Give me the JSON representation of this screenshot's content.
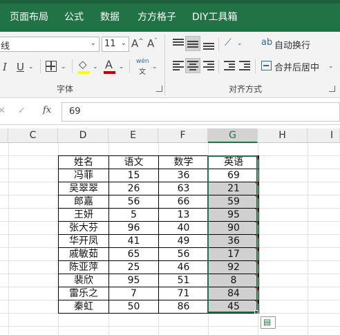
{
  "menu": {
    "tabs": [
      "页面布局",
      "公式",
      "数据",
      "方方格子",
      "DIY工具箱"
    ]
  },
  "ribbon": {
    "font_name_partial": "线",
    "font_size": "11",
    "grow_font": "A^",
    "shrink_font": "A˅",
    "italic": "I",
    "underline": "U",
    "font_color_glyph": "A",
    "phonetic_glyph": "wén",
    "phonetic_sub": "文",
    "wrap_text": "自动换行",
    "merge_center": "合并后居中",
    "group_font": "字体",
    "group_alignment": "对齐方式",
    "colors": {
      "fill_highlight": "#ffff00",
      "font_color": "#c00000",
      "accent": "#217346"
    },
    "icons": [
      "align-top-icon",
      "align-middle-icon",
      "align-bottom-icon",
      "orientation-icon",
      "wrap-text-icon",
      "align-left-icon",
      "align-center-icon",
      "align-right-icon",
      "decrease-indent-icon",
      "increase-indent-icon",
      "merge-center-icon",
      "borders-icon",
      "fill-color-icon",
      "font-color-icon",
      "phonetic-icon"
    ]
  },
  "formula_bar": {
    "cancel_icon": "✕",
    "enter_icon": "✓",
    "fx_label": "fx",
    "value": "69"
  },
  "columns": {
    "C": "C",
    "D": "D",
    "E": "E",
    "F": "F",
    "G": "G",
    "H": "H",
    "I": "I"
  },
  "table": {
    "headers": [
      "姓名",
      "语文",
      "数学",
      "英语"
    ],
    "rows": [
      [
        "冯菲",
        "15",
        "36",
        "69"
      ],
      [
        "吴翠翠",
        "26",
        "63",
        "21"
      ],
      [
        "郎嘉",
        "56",
        "66",
        "59"
      ],
      [
        "王妍",
        "5",
        "13",
        "95"
      ],
      [
        "张大芬",
        "96",
        "40",
        "90"
      ],
      [
        "华开凤",
        "41",
        "49",
        "36"
      ],
      [
        "戚敏茹",
        "65",
        "56",
        "17"
      ],
      [
        "陈亚萍",
        "25",
        "46",
        "92"
      ],
      [
        "裴欣",
        "95",
        "51",
        "8"
      ],
      [
        "雷乐之",
        "7",
        "71",
        "84"
      ],
      [
        "秦虹",
        "50",
        "86",
        "45"
      ]
    ]
  }
}
